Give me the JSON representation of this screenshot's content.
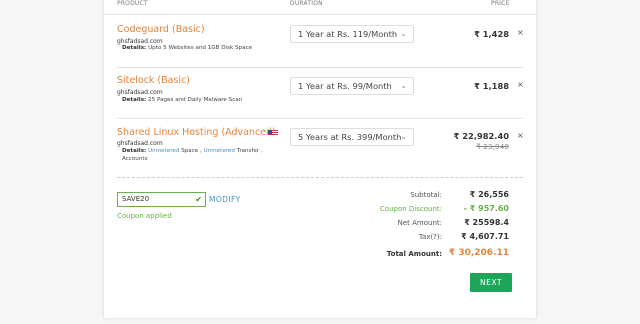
{
  "header": {
    "product": "PRODUCT",
    "duration": "DURATION",
    "price": "PRICE"
  },
  "items": [
    {
      "name": "Codeguard (Basic)",
      "domain": "ghsfadsad.com",
      "details_label": "Details:",
      "details_text": "Upto 5 Websites and 1GB Disk Space",
      "duration": "1 Year at Rs. 119/Month",
      "price": "₹ 1,428",
      "remove": "×"
    },
    {
      "name": "Sitelock (Basic)",
      "domain": "ghsfadsad.com",
      "details_label": "Details:",
      "details_text": "25 Pages and Daily Malware Scan",
      "duration": "1 Year at Rs. 99/Month",
      "price": "₹ 1,188",
      "remove": "×"
    },
    {
      "name": "Shared Linux Hosting (Advanced)",
      "domain": "ghsfadsad.com",
      "details_label": "Details:",
      "details_unmetered1": "Unmetered",
      "details_space": "Space ,",
      "details_unmetered2": "Unmetered",
      "details_transfer": "Transfer ,",
      "details_accounts": "Accounts",
      "duration": "5 Years at Rs. 399/Month",
      "price": "₹ 22,982.40",
      "old_price": "₹ 23,940",
      "remove": "×",
      "flag_icon": "us-flag-icon"
    }
  ],
  "coupon": {
    "code": "SAVE20",
    "modify": "MODIFY",
    "applied": "Coupon applied"
  },
  "summary": {
    "subtotal_label": "Subtotal:",
    "subtotal": "₹ 26,556",
    "discount_label": "Coupon Discount:",
    "discount": "- ₹ 957.60",
    "net_label": "Net Amount:",
    "net": "₹ 25598.4",
    "tax_label": "Tax(?):",
    "tax": "₹ 4,607.71",
    "total_label": "Total Amount:",
    "total": "₹ 30,206.11"
  },
  "next_button": "NEXT",
  "colors": {
    "accent": "#e4843b",
    "green": "#6ab04c",
    "button": "#1fa55a",
    "link": "#4a90c2"
  }
}
